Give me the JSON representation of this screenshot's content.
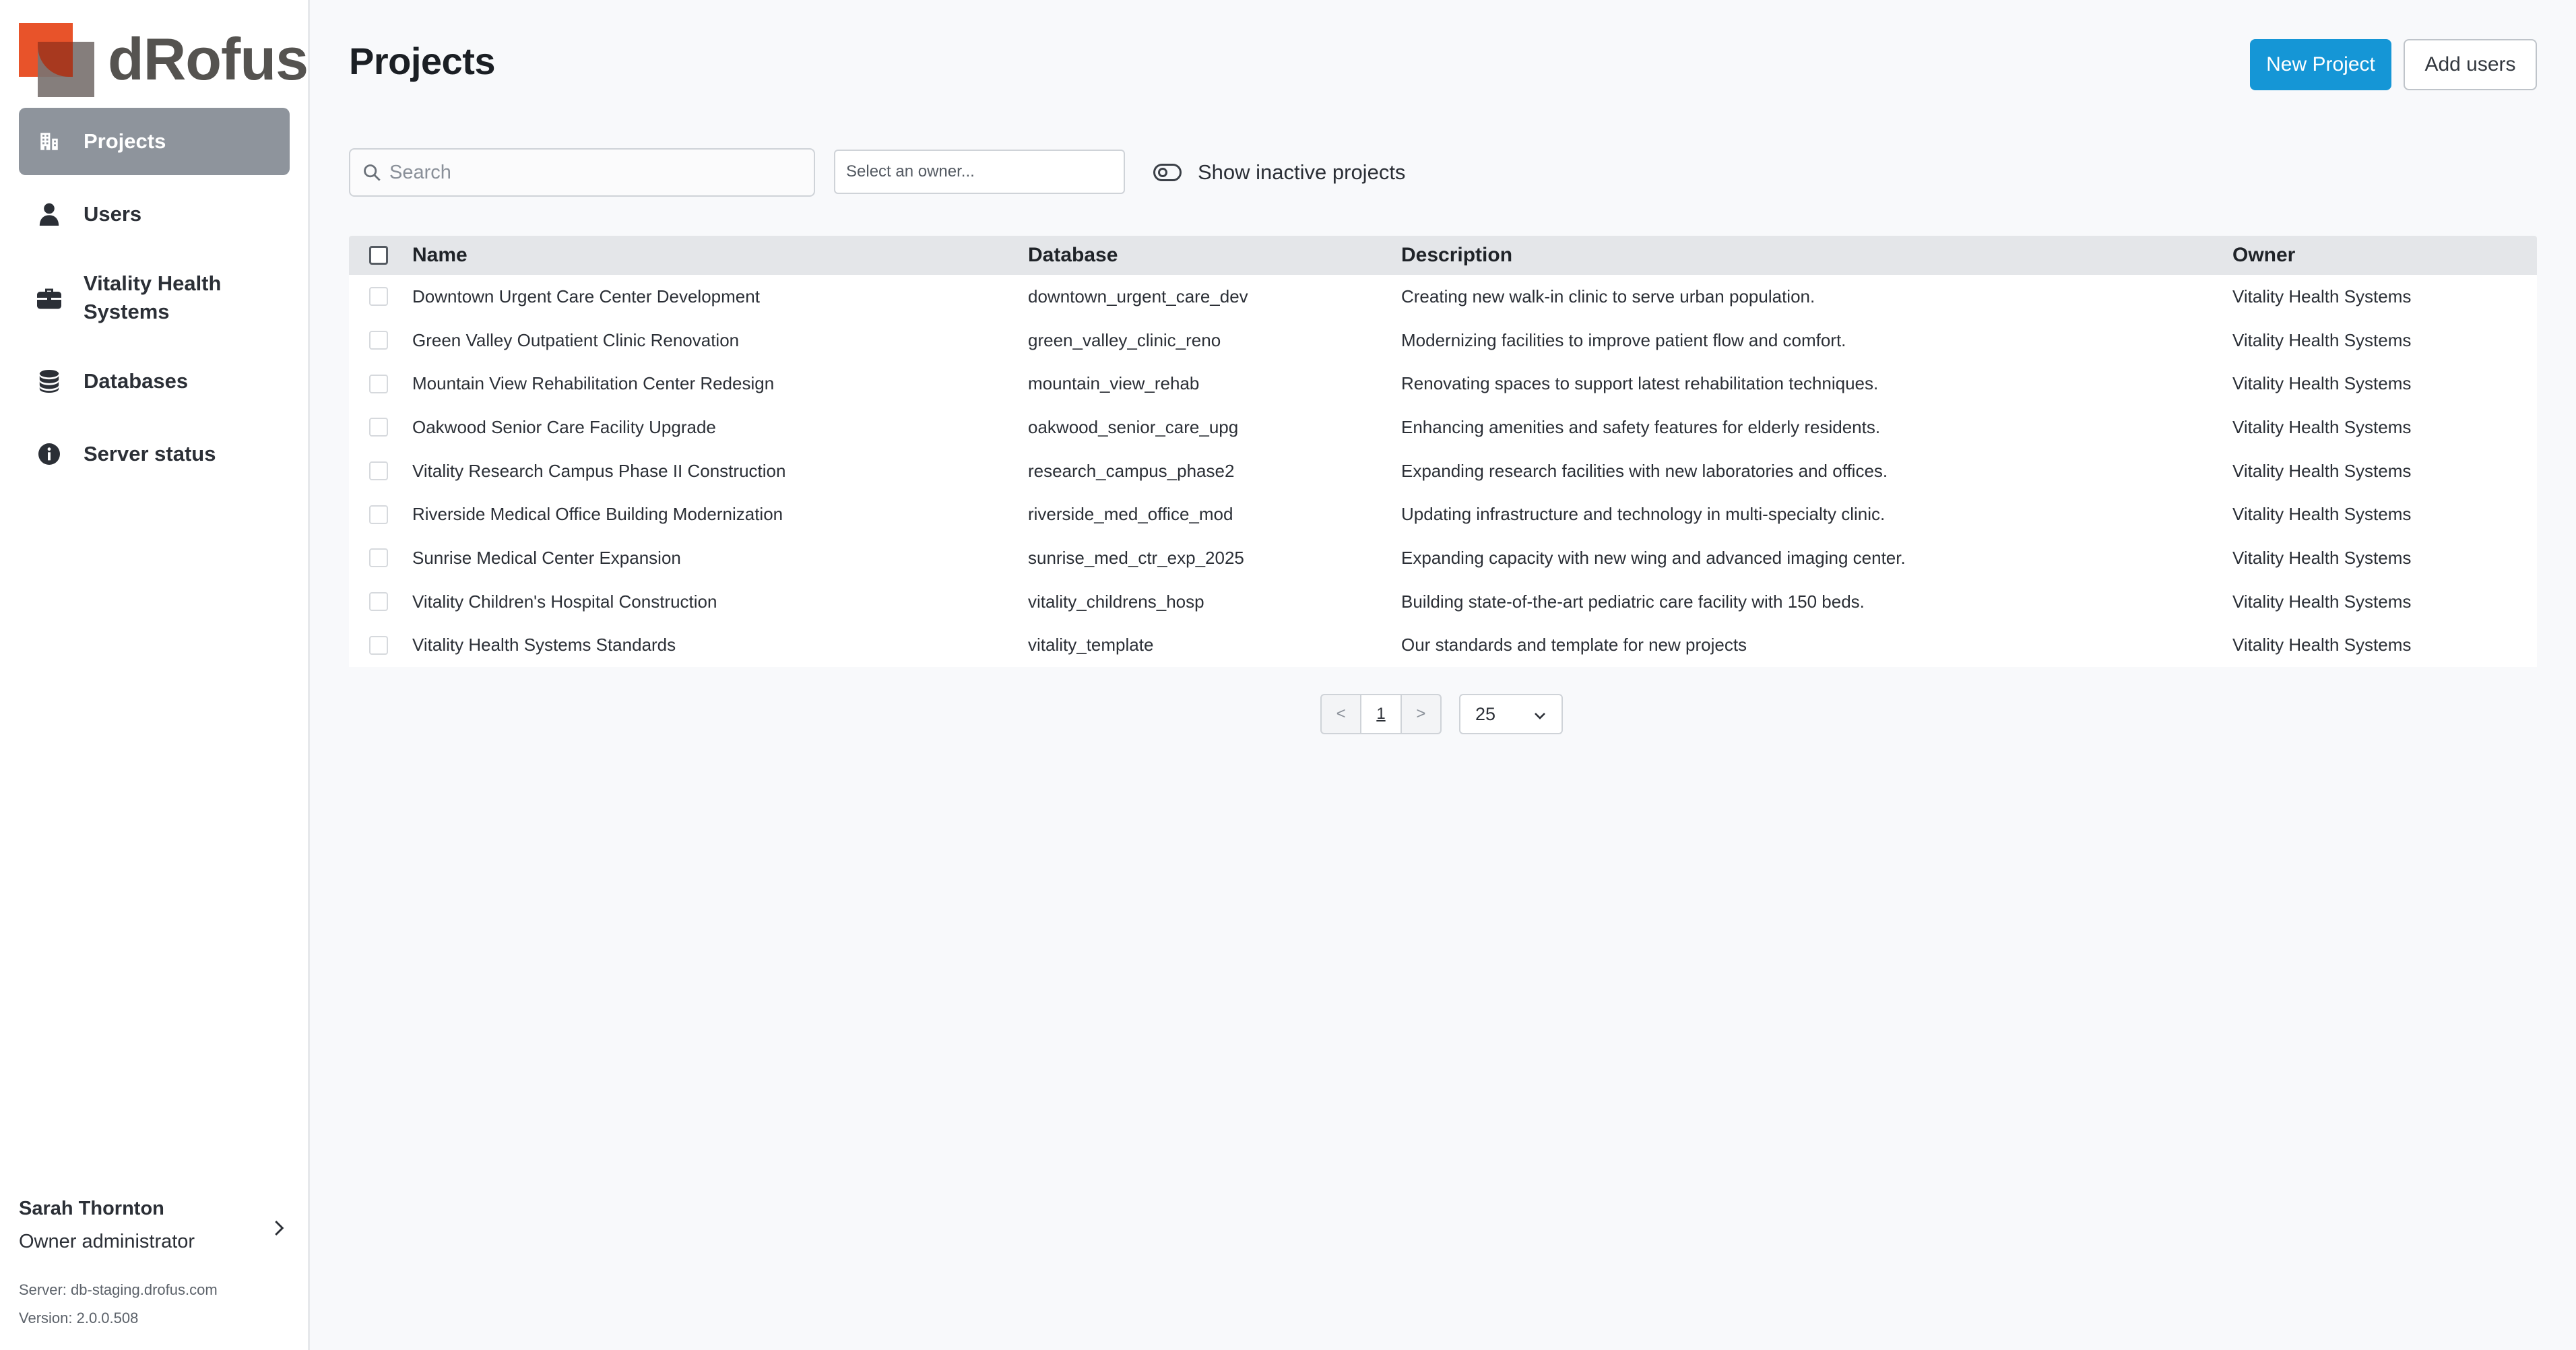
{
  "app": {
    "logo_text": "dRofus",
    "page_title": "Projects"
  },
  "sidebar": {
    "items": [
      {
        "label": "Projects",
        "icon": "building-icon",
        "active": true
      },
      {
        "label": "Users",
        "icon": "user-icon",
        "active": false
      },
      {
        "label": "Vitality Health Systems",
        "icon": "briefcase-icon",
        "active": false
      },
      {
        "label": "Databases",
        "icon": "database-icon",
        "active": false
      },
      {
        "label": "Server status",
        "icon": "info-icon",
        "active": false
      }
    ],
    "user": {
      "name": "Sarah Thornton",
      "role": "Owner administrator",
      "server": "Server: db-staging.drofus.com",
      "version": "Version: 2.0.0.508"
    }
  },
  "toolbar": {
    "new_project_label": "New Project",
    "add_users_label": "Add users",
    "search_placeholder": "Search",
    "owner_placeholder": "Select an owner...",
    "show_inactive_label": "Show inactive projects"
  },
  "table": {
    "columns": [
      "Name",
      "Database",
      "Description",
      "Owner"
    ],
    "rows": [
      [
        "Downtown Urgent Care Center Development",
        "downtown_urgent_care_dev",
        "Creating new walk-in clinic to serve urban population.",
        "Vitality Health Systems"
      ],
      [
        "Green Valley Outpatient Clinic Renovation",
        "green_valley_clinic_reno",
        "Modernizing facilities to improve patient flow and comfort.",
        "Vitality Health Systems"
      ],
      [
        "Mountain View Rehabilitation Center Redesign",
        "mountain_view_rehab",
        "Renovating spaces to support latest rehabilitation techniques.",
        "Vitality Health Systems"
      ],
      [
        "Oakwood Senior Care Facility Upgrade",
        "oakwood_senior_care_upg",
        "Enhancing amenities and safety features for elderly residents.",
        "Vitality Health Systems"
      ],
      [
        "Vitality Research Campus Phase II Construction",
        "research_campus_phase2",
        "Expanding research facilities with new laboratories and offices.",
        "Vitality Health Systems"
      ],
      [
        "Riverside Medical Office Building Modernization",
        "riverside_med_office_mod",
        "Updating infrastructure and technology in multi-specialty clinic.",
        "Vitality Health Systems"
      ],
      [
        "Sunrise Medical Center Expansion",
        "sunrise_med_ctr_exp_2025",
        "Expanding capacity with new wing and advanced imaging center.",
        "Vitality Health Systems"
      ],
      [
        "Vitality Children's Hospital Construction",
        "vitality_childrens_hosp",
        "Building state-of-the-art pediatric care facility with 150 beds.",
        "Vitality Health Systems"
      ],
      [
        "Vitality Health Systems Standards",
        "vitality_template",
        "Our standards and template for new projects",
        "Vitality Health Systems"
      ]
    ]
  },
  "pagination": {
    "prev": "<",
    "current_page": "1",
    "next": ">",
    "page_size": "25"
  },
  "colors": {
    "accent": "#1596d6",
    "active_nav": "#8e949c",
    "logo_red": "#e8532a",
    "logo_grey": "#7b7371"
  }
}
